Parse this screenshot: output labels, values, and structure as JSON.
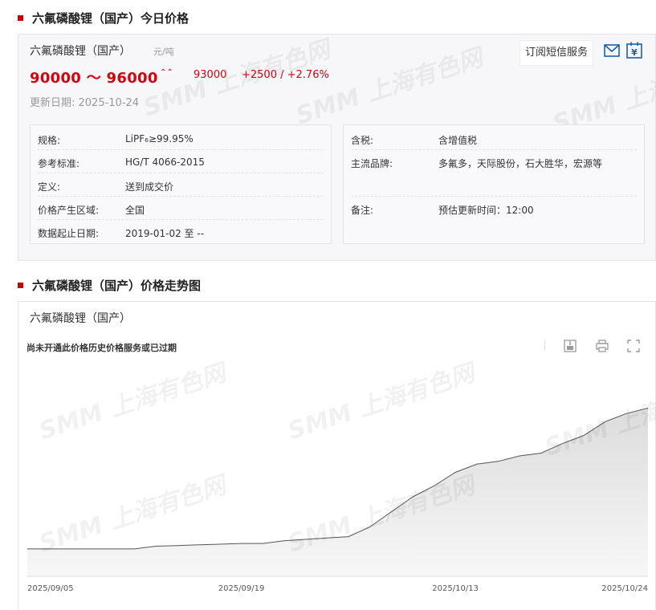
{
  "sections": {
    "today_title": "六氟磷酸锂（国产）今日价格",
    "trend_title": "六氟磷酸锂（国产）价格走势图"
  },
  "price": {
    "product": "六氟磷酸锂（国产）",
    "unit": "元/吨",
    "range": "90000 ～ 96000",
    "trend_icon": "up-arrow-icon",
    "average": "93000",
    "change": "+2500 / +2.76%",
    "updated": "更新日期:  2025-10-24",
    "subscribe_button": "订阅短信服务",
    "accent_color": "#d7000f"
  },
  "info_left": [
    {
      "label": "规格:",
      "value": "LiPF₆≥99.95%"
    },
    {
      "label": "参考标准:",
      "value": "HG/T 4066-2015"
    },
    {
      "label": "定义:",
      "value": "送到成交价"
    },
    {
      "label": "价格产生区域:",
      "value": "全国"
    },
    {
      "label": "数据起止日期:",
      "value": "2019-01-02 至 --"
    }
  ],
  "info_right": [
    {
      "label": "含税:",
      "value": "含增值税"
    },
    {
      "label": "主流品牌:",
      "value": "多氟多，天际股份，石大胜华，宏源等"
    },
    {
      "label": "备注:",
      "value": "预估更新时间：12:00"
    }
  ],
  "watermark": "SMM 上海有色网",
  "chart": {
    "subtitle": "六氟磷酸锂（国产）",
    "message": "尚未开通此价格历史价格服务或已过期",
    "tools": [
      "download-icon",
      "print-icon",
      "fullscreen-icon"
    ]
  },
  "chart_data": {
    "type": "area",
    "x": [
      "2025/09/05",
      "2025/09/08",
      "2025/09/09",
      "2025/09/10",
      "2025/09/11",
      "2025/09/12",
      "2025/09/15",
      "2025/09/16",
      "2025/09/17",
      "2025/09/18",
      "2025/09/19",
      "2025/09/22",
      "2025/09/23",
      "2025/09/24",
      "2025/09/25",
      "2025/09/26",
      "2025/09/29",
      "2025/09/30",
      "2025/10/09",
      "2025/10/10",
      "2025/10/13",
      "2025/10/14",
      "2025/10/15",
      "2025/10/16",
      "2025/10/17",
      "2025/10/20",
      "2025/10/21",
      "2025/10/22",
      "2025/10/23",
      "2025/10/24"
    ],
    "x_tick_labels": [
      "2025/09/05",
      "2025/09/19",
      "2025/10/13",
      "2025/10/24"
    ],
    "series": [
      {
        "values": [
          55000,
          55000,
          55000,
          55000,
          55000,
          55000,
          56000,
          56250,
          56500,
          56750,
          57000,
          57000,
          58000,
          58500,
          59000,
          59500,
          63000,
          68500,
          74000,
          78000,
          83000,
          86000,
          87000,
          89000,
          90000,
          93500,
          96500,
          101500,
          104500,
          106500
        ]
      }
    ],
    "ylim": [
      45000,
      116000
    ],
    "line_color": "#555555",
    "fill_color": "#e8e8e8",
    "grid": false,
    "yaxis_labels_visible": false
  }
}
